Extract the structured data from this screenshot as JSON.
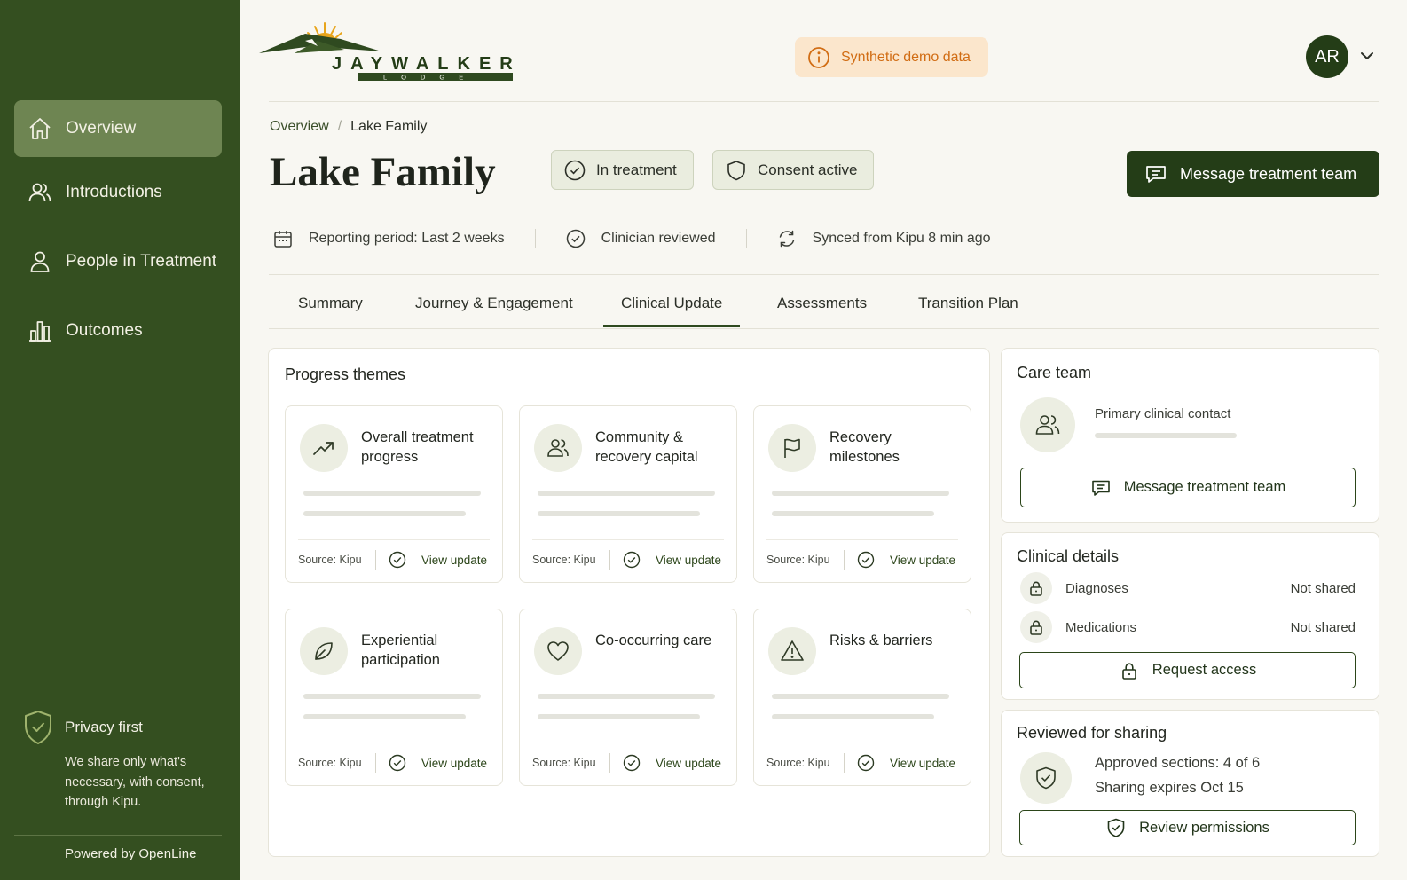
{
  "sidebar": {
    "nav": [
      {
        "label": "Overview",
        "icon": "home-icon",
        "active": true
      },
      {
        "label": "Introductions",
        "icon": "people-icon",
        "active": false
      },
      {
        "label": "People in Treatment",
        "icon": "person-icon",
        "active": false
      },
      {
        "label": "Outcomes",
        "icon": "bar-chart-icon",
        "active": false
      }
    ],
    "privacy_title": "Privacy first",
    "privacy_text": "We share only what's necessary, with consent, through Kipu.",
    "powered_by": "Powered by OpenLine"
  },
  "header": {
    "logo_text": "JAYWALKER",
    "logo_subtext": "LODGE",
    "demo_badge": "Synthetic demo data",
    "avatar_initials": "AR"
  },
  "breadcrumb": {
    "root": "Overview",
    "separator": "/",
    "current": "Lake Family"
  },
  "page": {
    "title": "Lake Family",
    "status_pill": "In treatment",
    "consent_pill": "Consent active",
    "message_button": "Message treatment team"
  },
  "meta": {
    "reporting_period": "Reporting period: Last 2 weeks",
    "reviewed": "Clinician reviewed",
    "synced": "Synced from Kipu 8 min ago"
  },
  "tabs": [
    "Summary",
    "Journey & Engagement",
    "Clinical Update",
    "Assessments",
    "Transition Plan"
  ],
  "active_tab": "Clinical Update",
  "progress_themes": {
    "title": "Progress themes",
    "cards": [
      {
        "title": "Overall treatment progress",
        "icon": "trend-up-icon",
        "source": "Source: Kipu",
        "link": "View update"
      },
      {
        "title": "Community & recovery capital",
        "icon": "community-icon",
        "source": "Source: Kipu",
        "link": "View update"
      },
      {
        "title": "Recovery milestones",
        "icon": "flag-icon",
        "source": "Source: Kipu",
        "link": "View update"
      },
      {
        "title": "Experiential participation",
        "icon": "leaf-icon",
        "source": "Source: Kipu",
        "link": "View update"
      },
      {
        "title": "Co-occurring care",
        "icon": "heart-icon",
        "source": "Source: Kipu",
        "link": "View update"
      },
      {
        "title": "Risks & barriers",
        "icon": "warning-icon",
        "source": "Source: Kipu",
        "link": "View update"
      }
    ]
  },
  "care_team": {
    "title": "Care team",
    "contact_label": "Primary clinical contact",
    "button": "Message treatment team"
  },
  "clinical_details": {
    "title": "Clinical details",
    "rows": [
      {
        "label": "Diagnoses",
        "value": "Not shared"
      },
      {
        "label": "Medications",
        "value": "Not shared"
      }
    ],
    "button": "Request access"
  },
  "sharing": {
    "title": "Reviewed for sharing",
    "approved": "Approved sections: 4 of 6",
    "expires": "Sharing expires Oct 15",
    "button": "Review permissions"
  },
  "colors": {
    "sidebar": "#344f20",
    "sidebar_active": "#6e8552",
    "primary": "#243d17",
    "demo_badge_bg": "#fbe6cc",
    "demo_badge_text": "#d16d14",
    "logo_sun": "#e8a51c"
  }
}
